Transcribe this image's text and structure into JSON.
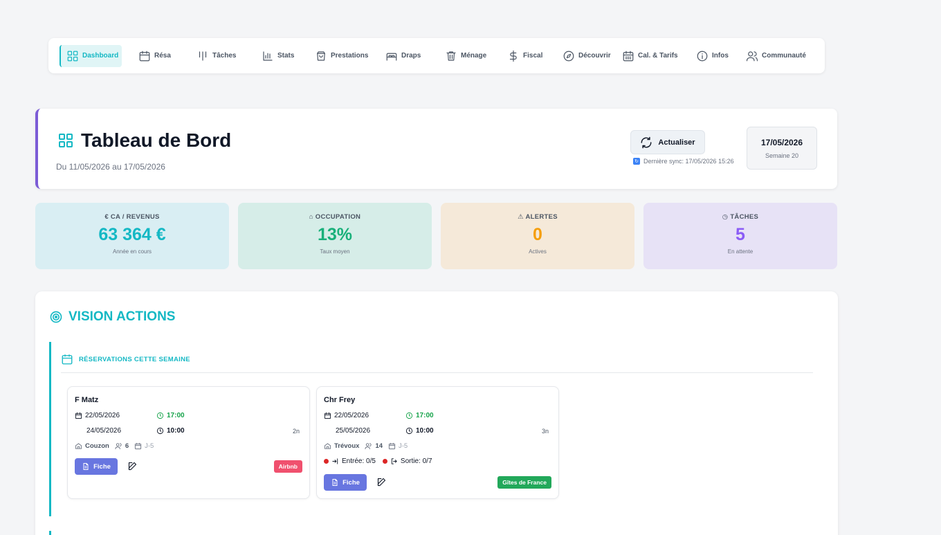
{
  "nav": {
    "items": [
      {
        "label": "Dashboard",
        "icon": "grid-icon"
      },
      {
        "label": "Résa",
        "icon": "calendar-icon"
      },
      {
        "label": "Tâches",
        "icon": "tasks-icon"
      },
      {
        "label": "Stats",
        "icon": "bar-chart-icon"
      },
      {
        "label": "Prestations",
        "icon": "bag-icon"
      },
      {
        "label": "Draps",
        "icon": "bed-icon"
      },
      {
        "label": "Ménage",
        "icon": "trash-icon"
      },
      {
        "label": "Fiscal",
        "icon": "dollar-icon"
      },
      {
        "label": "Découvrir",
        "icon": "compass-icon"
      },
      {
        "label": "Cal. & Tarifs",
        "icon": "calendar-grid-icon"
      },
      {
        "label": "Infos",
        "icon": "info-icon"
      },
      {
        "label": "Communauté",
        "icon": "users-icon"
      }
    ],
    "active_color": "#14b8c4"
  },
  "header": {
    "title": "Tableau de Bord",
    "subtitle": "Du 11/05/2026 au 17/05/2026",
    "refresh_label": "Actualiser",
    "sync_text": "Dernière sync: 17/05/2026 15:26",
    "date": "17/05/2026",
    "week": "Semaine 20",
    "accent": "#7c5cd6"
  },
  "stats": [
    {
      "label": "€ CA / REVENUS",
      "value": "63 364 €",
      "sub": "Année en cours",
      "bg": "#d9eef3",
      "color": "#14b8c4"
    },
    {
      "label": "⌂ OCCUPATION",
      "value": "13%",
      "sub": "Taux moyen",
      "bg": "#d6ede8",
      "color": "#19b07a"
    },
    {
      "label": "⚠ ALERTES",
      "value": "0",
      "sub": "Actives",
      "bg": "#f5e9d9",
      "color": "#f59e0b"
    },
    {
      "label": "◷ TÂCHES",
      "value": "5",
      "sub": "En attente",
      "bg": "#e7e2f6",
      "color": "#8b5cf6"
    }
  ],
  "actions": {
    "title": "VISION ACTIONS",
    "section_title": "RÉSERVATIONS CETTE SEMAINE",
    "reservations": [
      {
        "name": "F Matz",
        "arrival_date": "22/05/2026",
        "arrival_time": "17:00",
        "departure_date": "24/05/2026",
        "departure_time": "10:00",
        "nights": "2n",
        "gite": "Couzon",
        "guests": "6",
        "countdown": "J-5",
        "fiche_label": "Fiche",
        "platform": "Airbnb",
        "platform_color": "#f0506e"
      },
      {
        "name": "Chr Frey",
        "arrival_date": "22/05/2026",
        "arrival_time": "17:00",
        "departure_date": "25/05/2026",
        "departure_time": "10:00",
        "nights": "3n",
        "gite": "Trévoux",
        "guests": "14",
        "countdown": "J-5",
        "entree": "Entrée: 0/5",
        "sortie": "Sortie: 0/7",
        "fiche_label": "Fiche",
        "platform": "Gîtes de France",
        "platform_color": "#22a85a"
      }
    ]
  }
}
